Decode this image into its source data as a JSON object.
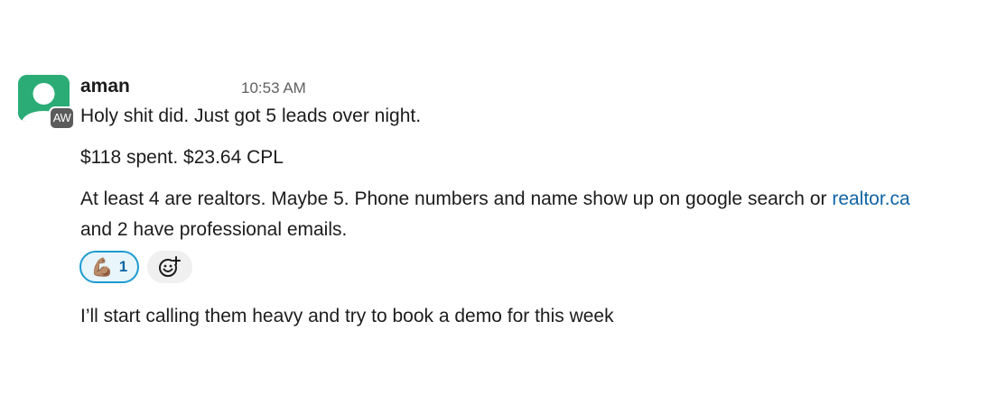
{
  "message": {
    "author": "aman",
    "timestamp": "10:53 AM",
    "avatar_badge": "AW",
    "avatar_color": "#2bac76",
    "lines": {
      "line1": "Holy shit did. Just got 5 leads over night.",
      "line2": "$118 spent. $23.64 CPL",
      "line3_prefix": "At least 4 are realtors. Maybe 5. Phone numbers and name show up on google search or ",
      "line3_link": "realtor.ca",
      "line4": "and 2 have professional emails.",
      "line5": "I’ll start calling them heavy and try to book a demo for this week"
    },
    "link_color": "#1264a3",
    "reaction": {
      "emoji": "💪🏽",
      "icon": "flexed-biceps-icon",
      "count": "1"
    },
    "add_reaction_icon": "add-emoji-icon"
  }
}
